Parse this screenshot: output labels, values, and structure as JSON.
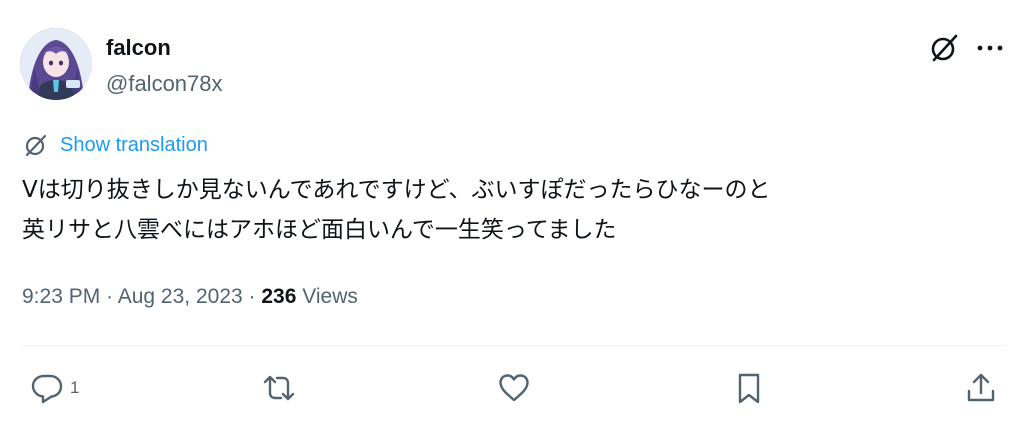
{
  "author": {
    "display_name": "falcon",
    "handle": "@falcon78x"
  },
  "header_icons": [
    "grok-icon",
    "more-icon"
  ],
  "translation": {
    "label": "Show translation"
  },
  "tweet": {
    "text": "Vは切り抜きしか見ないんであれですけど、ぶいすぽだったらひなーのと\n英リサと八雲べにはアホほど面白いんで一生笑ってました"
  },
  "meta": {
    "time": "9:23 PM",
    "sep1": " · ",
    "date": "Aug 23, 2023",
    "sep2": " · ",
    "views_count": "236",
    "views_label": " Views"
  },
  "actions": {
    "reply_count": "1",
    "icons": [
      "reply-icon",
      "retweet-icon",
      "like-icon",
      "bookmark-icon",
      "share-icon"
    ]
  },
  "colors": {
    "text": "#0f1419",
    "secondary": "#536471",
    "accent": "#1d9bf0",
    "divider": "#eff3f4"
  }
}
